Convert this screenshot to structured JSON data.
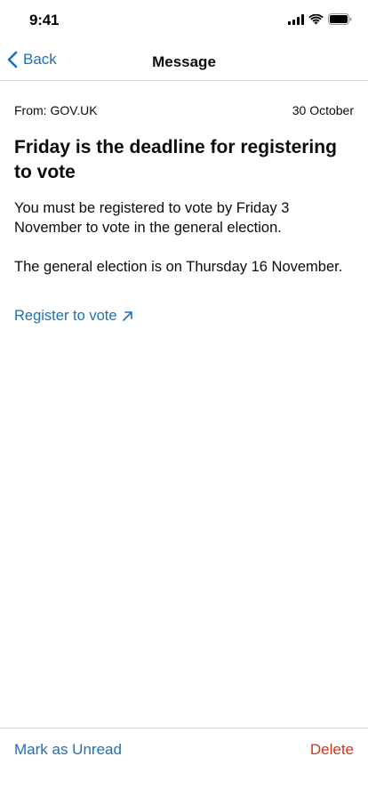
{
  "status_bar": {
    "time": "9:41",
    "icons": [
      "signal-icon",
      "wifi-icon",
      "battery-icon"
    ]
  },
  "nav": {
    "back_label": "Back",
    "title": "Message"
  },
  "message": {
    "from": "From: GOV.UK",
    "date": "30 October",
    "title": "Friday is the deadline for registering to vote",
    "paragraphs": [
      "You must be registered to vote by Friday 3 November to vote in the general election.",
      "The general election is on Thursday 16 November."
    ],
    "link_label": "Register to vote",
    "link_icon": "external-arrow-icon"
  },
  "toolbar": {
    "mark_unread_label": "Mark as Unread",
    "delete_label": "Delete"
  },
  "colors": {
    "link": "#1d70b8",
    "danger": "#d4351c",
    "text": "#0b0c0c",
    "divider": "#d9d9d9"
  }
}
